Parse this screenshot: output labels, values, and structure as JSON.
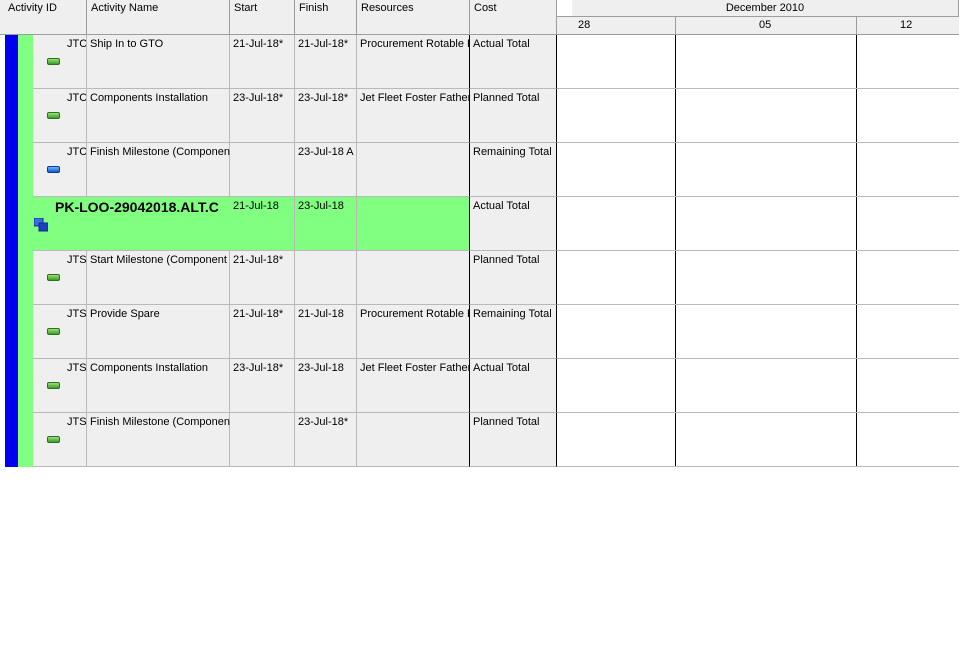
{
  "columns": {
    "activity_id": "Activity ID",
    "activity_name": "Activity Name",
    "start": "Start",
    "finish": "Finish",
    "resources": "Resources",
    "cost": "Cost"
  },
  "timescale": {
    "month": "December 2010",
    "weeks": [
      "28",
      "05",
      "12"
    ]
  },
  "rows": [
    {
      "id": "JTC",
      "name": "Ship In to GTO",
      "start": "21-Jul-18*",
      "finish": "21-Jul-18*",
      "resources": "Procurement Rotable F",
      "cost": "Actual Total",
      "icon": "green-bar-icon"
    },
    {
      "id": "JTC",
      "name": "Components Installation",
      "start": "23-Jul-18*",
      "finish": "23-Jul-18*",
      "resources": "Jet Fleet Foster Father",
      "cost": "Planned Total",
      "icon": "green-bar-icon"
    },
    {
      "id": "JTC",
      "name": "Finish Milestone (Component",
      "start": "",
      "finish": "23-Jul-18 A",
      "resources": "",
      "cost": "Remaining Total",
      "icon": "blue-bar-icon"
    },
    {
      "id": "",
      "name": "PK-LOO-29042018.ALT.C",
      "start": "21-Jul-18",
      "finish": "23-Jul-18",
      "resources": "",
      "cost": "Actual Total",
      "icon": "wbs-group-icon"
    },
    {
      "id": "JTS",
      "name": "Start Milestone (Component",
      "start": "21-Jul-18*",
      "finish": "",
      "resources": "",
      "cost": "Planned Total",
      "icon": "green-bar-icon"
    },
    {
      "id": "JTS",
      "name": "Provide Spare",
      "start": "21-Jul-18*",
      "finish": "21-Jul-18",
      "resources": "Procurement Rotable F",
      "cost": "Remaining Total",
      "icon": "green-bar-icon"
    },
    {
      "id": "JTS",
      "name": "Components Installation",
      "start": "23-Jul-18*",
      "finish": "23-Jul-18",
      "resources": "Jet Fleet Foster Father",
      "cost": "Actual Total",
      "icon": "green-bar-icon"
    },
    {
      "id": "JTS",
      "name": "Finish Milestone (Component",
      "start": "",
      "finish": "23-Jul-18*",
      "resources": "",
      "cost": "Planned Total",
      "icon": "green-bar-icon"
    }
  ],
  "colors": {
    "header_bg": "#efefef",
    "cell_bg": "#efefef",
    "wbs_band": "#0000ee",
    "wbs_sub_band": "#80ff80",
    "wbs_row_bg": "#80ff80",
    "grid_line": "#b9b9b9"
  }
}
